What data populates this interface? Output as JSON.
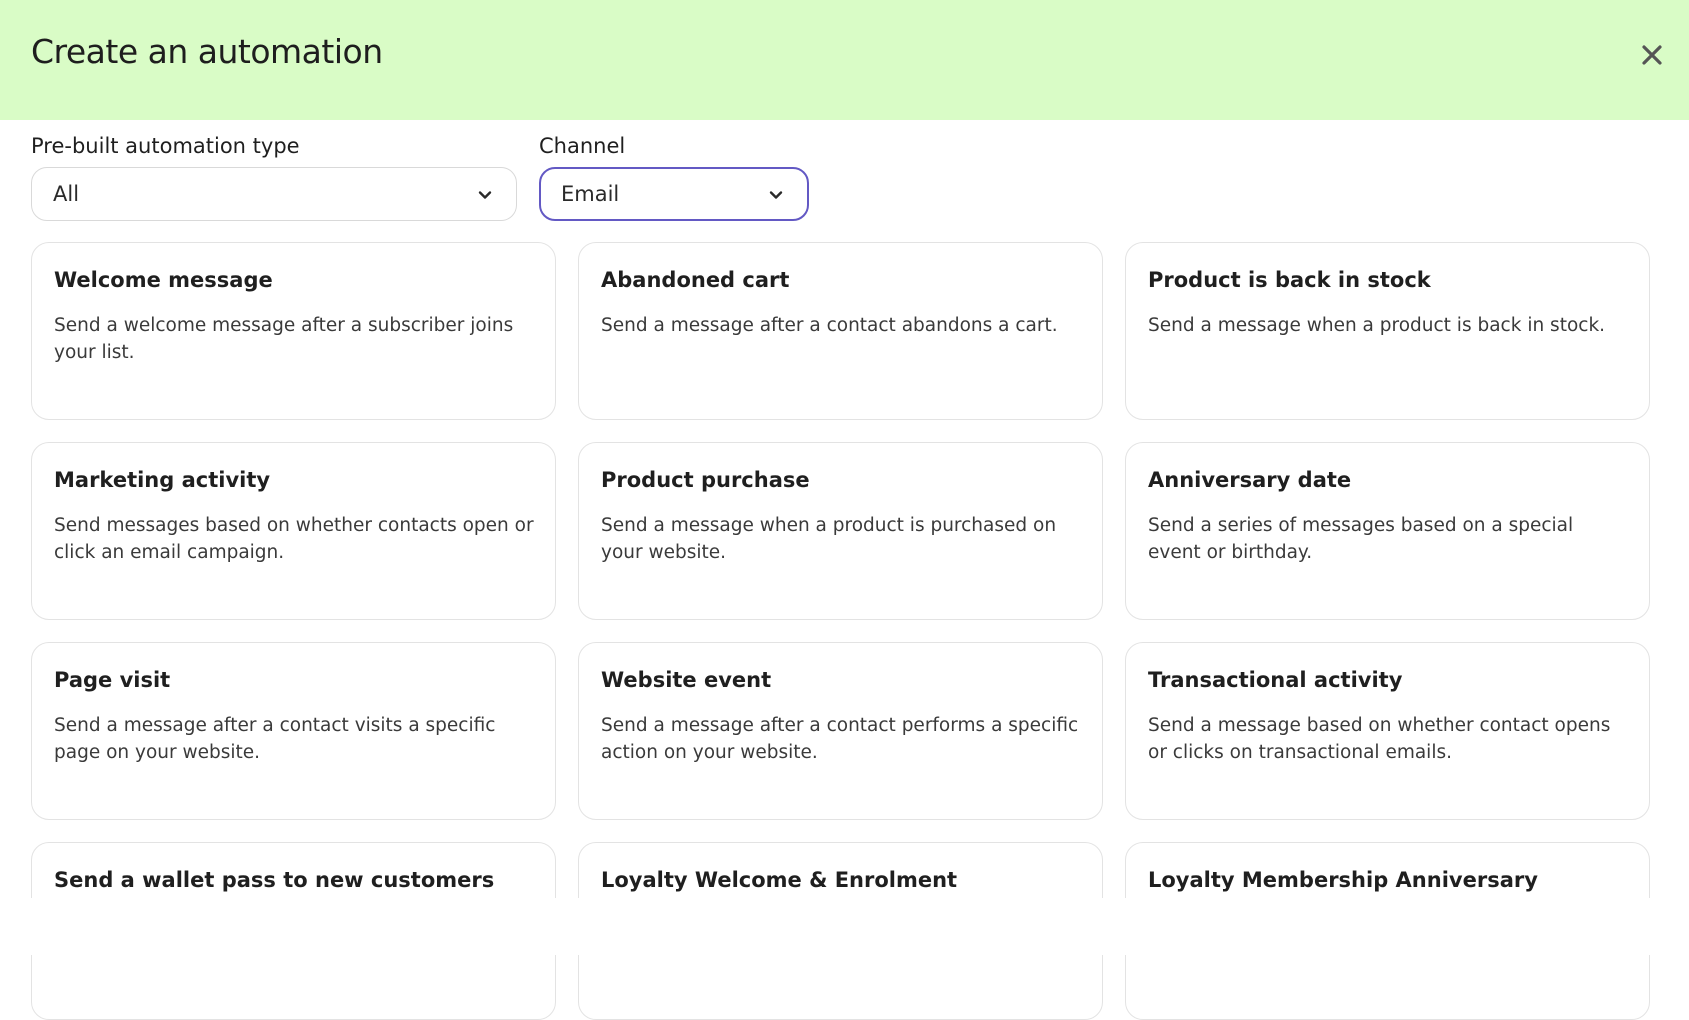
{
  "dialog": {
    "title": "Create an automation",
    "close_icon": "close-icon"
  },
  "filters": {
    "type": {
      "label": "Pre-built automation type",
      "value": "All",
      "icon": "chevron-down-icon"
    },
    "channel": {
      "label": "Channel",
      "value": "Email",
      "icon": "chevron-down-icon"
    }
  },
  "cards": [
    {
      "title": "Welcome message",
      "description": "Send a welcome message after a subscriber joins your list."
    },
    {
      "title": "Abandoned cart",
      "description": "Send a message after a contact abandons a cart."
    },
    {
      "title": "Product is back in stock",
      "description": "Send a message when a product is back in stock."
    },
    {
      "title": "Marketing activity",
      "description": "Send messages based on whether contacts open or click an email campaign."
    },
    {
      "title": "Product purchase",
      "description": "Send a message when a product is purchased on your website."
    },
    {
      "title": "Anniversary date",
      "description": "Send a series of messages based on a special event or birthday."
    },
    {
      "title": "Page visit",
      "description": "Send a message after a contact visits a specific page on your website."
    },
    {
      "title": "Website event",
      "description": "Send a message after a contact performs a specific action on your website."
    },
    {
      "title": "Transactional activity",
      "description": "Send a message based on whether contact opens or clicks on transactional emails."
    },
    {
      "title": "Send a wallet pass to new customers",
      "description": ""
    },
    {
      "title": "Loyalty Welcome & Enrolment",
      "description": ""
    },
    {
      "title": "Loyalty Membership Anniversary",
      "description": ""
    }
  ],
  "colors": {
    "header_bg": "#d9fcc6",
    "focus_border": "#6359c4",
    "card_border": "#e3e3e3"
  }
}
